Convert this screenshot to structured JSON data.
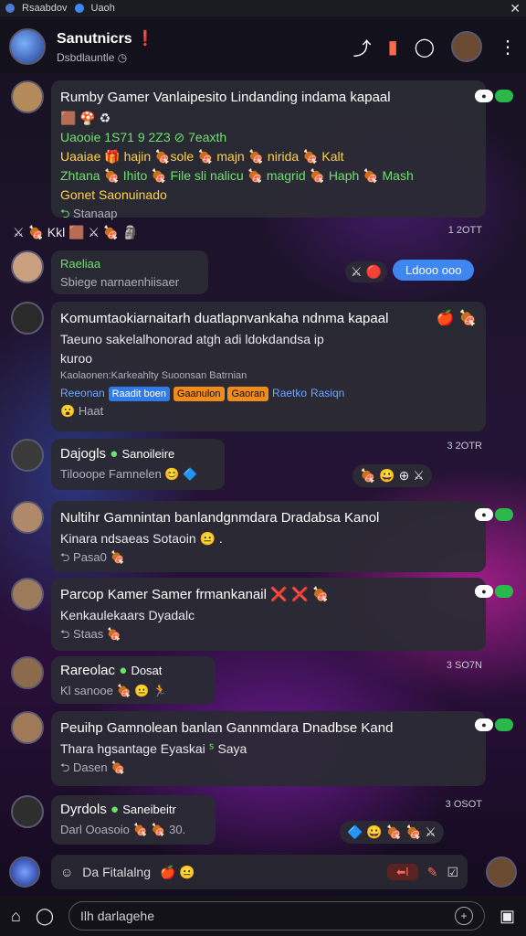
{
  "topbar": {
    "tab1": "Rsaabdov",
    "tab2": "Uaoh",
    "close": "✕"
  },
  "header": {
    "title": "Sanutnicrs",
    "title_badge": "❗",
    "subtitle": "Dsbdlauntle",
    "subtitle_badge": "◷"
  },
  "messages": [
    {
      "name": "Rumby Gamer Vanlaipesito Lindanding indama kapaal",
      "lines": [
        "Uaooie 1S71 9 2Z3 ⊘ 7eaxth",
        "Uaaiae 🎁 hajin 🍖sole 🍖 majn 🍖 nirida 🍖 Kalt",
        "Zhtana 🍖 Ihito 🍖 File sli nalicu 🍖 magrid 🍖 Haph 🍖 Mash",
        "Gonet Saonuinado"
      ],
      "footer": "Stanaap"
    },
    {
      "strip": "Kkl",
      "time": "1 2OTT"
    },
    {
      "name": "Raeliaa",
      "line": "Sbiege narnaenhiisaer",
      "button": "Ldooo ooo"
    },
    {
      "name": "Komumtaokiarnaitarh duatlapnvankaha ndnma kapaal",
      "lines": [
        "Taeuno sakelalhonorad atgh adi ldokdandsa ip",
        "kuroo"
      ],
      "sub": "Kaolaonen:Karkeahlty Suoonsan Batrnian",
      "tags": [
        "Reeonan",
        "Raadit boen",
        "Gaanulon",
        "Gaoran",
        "Raetko",
        "Rasiqn"
      ],
      "footer": "Haat"
    },
    {
      "name": "Dajogls",
      "status": "Sanoileire",
      "line": "Tilooope Famnelen",
      "time": "3 2OTR"
    },
    {
      "name": "Nultihr Gamnintan banlandgnmdara Dradabsa Kanol",
      "line": "Kinara ndsaeas Sotaoin",
      "footer": "Pasa0"
    },
    {
      "name": "Parcop Kamer Samer frmankanail",
      "line": "Kenkaulekaars Dyadalc",
      "footer": "Staas"
    },
    {
      "name": "Rareolac",
      "status": "Dosat",
      "line": "Kl sanooe",
      "time": "3 SO7N"
    },
    {
      "name": "Peuihp Gamnolean banlan Gannmdara Dnadbse Kand",
      "line": "Thara hgsantage Eyaskai",
      "line_tail": "Saya",
      "footer": "Dasen"
    },
    {
      "name": "Dyrdols",
      "status": "Saneibeitr",
      "line": "Darl Ooasoio",
      "line_tail": "30.",
      "time": "3 OSOT"
    }
  ],
  "composer": {
    "placeholder": "Da Fitalalng",
    "send_label": "⬅Ⅰ"
  },
  "bottom": {
    "search_placeholder": "Ilh darlagehe"
  }
}
